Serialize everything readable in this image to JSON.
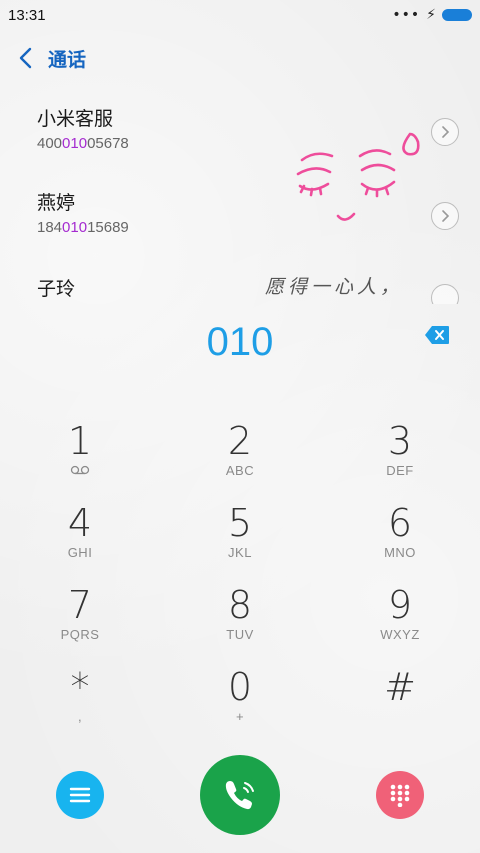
{
  "status_bar": {
    "time": "13:31",
    "battery_color": "#1a7fd8"
  },
  "header": {
    "title": "通话",
    "back_icon": "chevron-left-icon"
  },
  "contacts": [
    {
      "name": "小米客服",
      "number_pre": "400",
      "number_match": "010",
      "number_post": "05678"
    },
    {
      "name": "燕婷",
      "number_pre": "184",
      "number_match": "010",
      "number_post": "15689"
    },
    {
      "name": "子玲"
    }
  ],
  "wallpaper_text": "愿得一心人，",
  "dial_input": "010",
  "keys": [
    {
      "digit": "1",
      "letters": ""
    },
    {
      "digit": "2",
      "letters": "ABC"
    },
    {
      "digit": "3",
      "letters": "DEF"
    },
    {
      "digit": "4",
      "letters": "GHI"
    },
    {
      "digit": "5",
      "letters": "JKL"
    },
    {
      "digit": "6",
      "letters": "MNO"
    },
    {
      "digit": "7",
      "letters": "PQRS"
    },
    {
      "digit": "8",
      "letters": "TUV"
    },
    {
      "digit": "9",
      "letters": "WXYZ"
    },
    {
      "digit": "*",
      "letters": ","
    },
    {
      "digit": "0",
      "letters": "+"
    },
    {
      "digit": "#",
      "letters": ""
    }
  ],
  "colors": {
    "accent": "#1e9ee6",
    "match_highlight": "#a52bd0",
    "menu_button": "#18b4ef",
    "call_button": "#1aa34a",
    "keypad_button": "#f06178"
  },
  "icons": {
    "menu": "menu-icon",
    "call": "phone-icon",
    "keypad": "dialpad-icon",
    "backspace": "backspace-icon",
    "voicemail": "voicemail-icon"
  }
}
